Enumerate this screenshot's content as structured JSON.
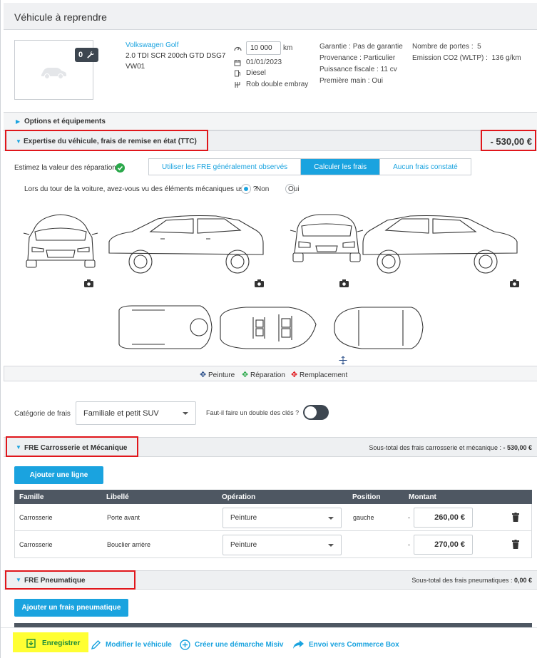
{
  "header": {
    "title": "Véhicule à reprendre"
  },
  "vehicle": {
    "photo_count": "0",
    "model": "Volkswagen Golf",
    "version": "2.0 TDI SCR 200ch GTD DSG7",
    "code": "VW01",
    "km_value": "10 000",
    "km_unit": "km",
    "date": "01/01/2023",
    "fuel": "Diesel",
    "gearbox": "Rob double embray",
    "specs": [
      {
        "label": "Garantie :",
        "value": "Pas de garantie"
      },
      {
        "label": "Provenance :",
        "value": "Particulier"
      },
      {
        "label": "Puissance fiscale :",
        "value": "11 cv"
      },
      {
        "label": "Première main :",
        "value": "Oui"
      },
      {
        "label": "Nombre de portes :",
        "value": "5"
      },
      {
        "label": "Emission CO2 (WLTP) :",
        "value": "136 g/km"
      }
    ]
  },
  "sections": {
    "options": "Options et équipements",
    "expertise": "Expertise du véhicule, frais de remise en état (TTC)",
    "expertise_total": "- 530,00 €"
  },
  "estimate": {
    "label": "Estimez la valeur des réparations",
    "options": [
      "Utiliser les FRE généralement observés",
      "Calculer les frais",
      "Aucun frais constaté"
    ],
    "active_index": 1
  },
  "mechanical": {
    "question": "Lors du tour de la voiture, avez-vous vu des éléments mécaniques usés ?",
    "no": "Non",
    "yes": "Oui"
  },
  "legend": {
    "paint": "Peinture",
    "repair": "Réparation",
    "replace": "Remplacement"
  },
  "category": {
    "label": "Catégorie de frais",
    "value": "Familiale et petit SUV",
    "keys_question": "Faut-il faire un double des clés ?"
  },
  "fre_body": {
    "title": "FRE Carrosserie et Mécanique",
    "subtotal_label": "Sous-total des frais carrosserie et mécanique :",
    "subtotal_value": "- 530,00 €",
    "add_button": "Ajouter une ligne",
    "columns": [
      "Famille",
      "Libellé",
      "Opération",
      "Position",
      "Montant"
    ],
    "rows": [
      {
        "family": "Carrosserie",
        "label": "Porte avant",
        "operation": "Peinture",
        "position": "gauche",
        "sign": "-",
        "amount": "260,00 €"
      },
      {
        "family": "Carrosserie",
        "label": "Bouclier arrière",
        "operation": "Peinture",
        "position": "",
        "sign": "-",
        "amount": "270,00 €"
      }
    ]
  },
  "fre_tires": {
    "title": "FRE Pneumatique",
    "subtotal_label": "Sous-total des frais pneumatiques :",
    "subtotal_value": "0,00 €",
    "add_button": "Ajouter un frais pneumatique"
  },
  "footer": {
    "save": "Enregistrer",
    "edit": "Modifier le véhicule",
    "create": "Créer une démarche Misiv",
    "send": "Envoi vers Commerce Box"
  },
  "colors": {
    "accent": "#1aa3df",
    "highlight_border": "#e0161b",
    "dark": "#3d4650",
    "save_highlight": "#ffff33"
  }
}
